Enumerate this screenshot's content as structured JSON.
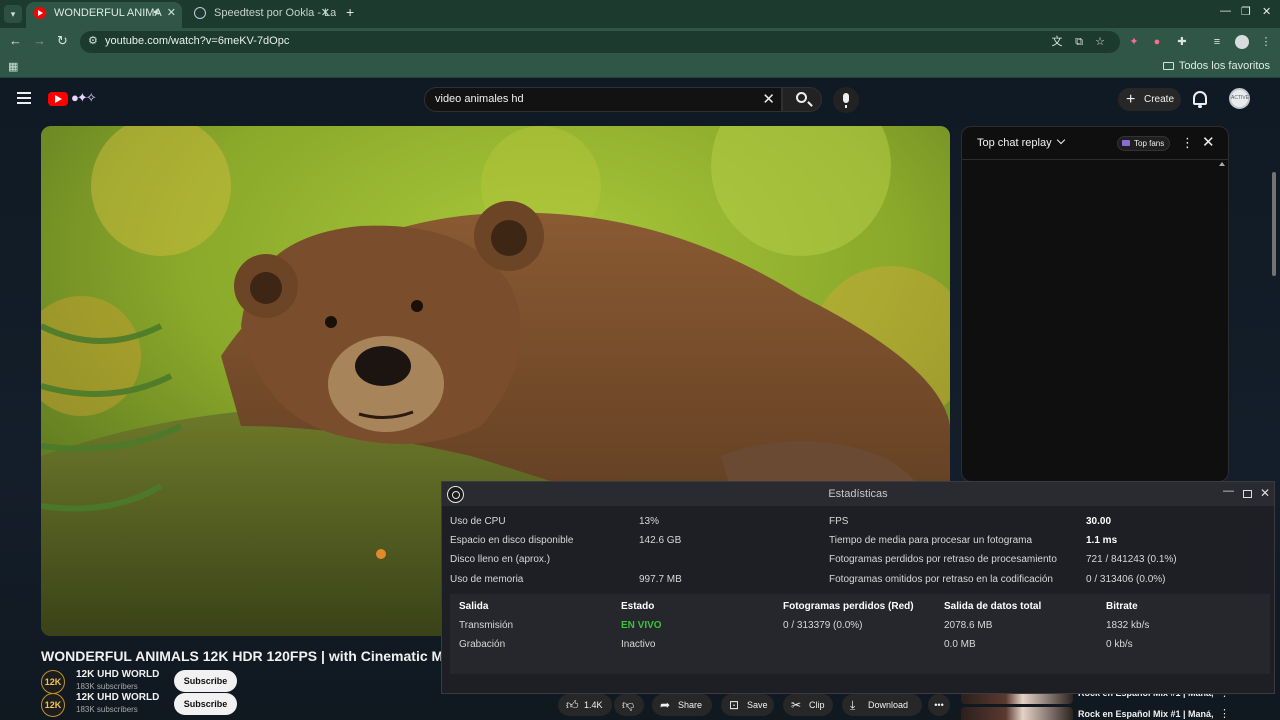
{
  "browser": {
    "tabs": [
      {
        "title": "WONDERFUL ANIMA",
        "active": true,
        "audio": true
      },
      {
        "title": "Speedtest por Ookla - La",
        "active": false
      }
    ],
    "url": "youtube.com/watch?v=6meKV-7dOpc",
    "bookmarks_folder": "Todos los favoritos"
  },
  "youtube": {
    "search_query": "video animales hd",
    "create_label": "Create",
    "avatar_text": "ACTIVE",
    "video": {
      "title": "WONDERFUL ANIMALS 12K HDR 120FPS | with Cinematic Music (C",
      "channel_avatar": "12K",
      "channel_name": "12K UHD WORLD",
      "subscribers": "183K subscribers",
      "subscribe_label": "Subscribe"
    },
    "actions": {
      "likes": "1.4K",
      "share": "Share",
      "save": "Save",
      "clip": "Clip",
      "download": "Download"
    },
    "chat": {
      "title": "Top chat replay",
      "badge": "Top fans"
    },
    "recommendations": [
      {
        "title": "Rock en Español Mix #1 | Maná,"
      },
      {
        "title": "Rock en Español Mix #1 | Maná,"
      }
    ]
  },
  "obs_stats": {
    "window_title": "Estadísticas",
    "left": [
      {
        "label": "Uso de CPU",
        "value": "13%"
      },
      {
        "label": "Espacio en disco disponible",
        "value": "142.6 GB"
      },
      {
        "label": "Disco lleno en (aprox.)",
        "value": ""
      },
      {
        "label": "Uso de memoria",
        "value": "997.7 MB"
      }
    ],
    "right": [
      {
        "label": "FPS",
        "value": "30.00"
      },
      {
        "label": "Tiempo de media para procesar un fotograma",
        "value": "1.1 ms"
      },
      {
        "label": "Fotogramas perdidos por retraso de procesamiento",
        "value": "721 / 841243 (0.1%)"
      },
      {
        "label": "Fotogramas omitidos por retraso en la codificación",
        "value": "0 / 313406 (0.0%)"
      }
    ],
    "table": {
      "headers": [
        "Salida",
        "Estado",
        "Fotogramas perdidos (Red)",
        "Salida de datos total",
        "Bitrate"
      ],
      "rows": [
        [
          "Transmisión",
          "EN VIVO",
          "0 / 313379 (0.0%)",
          "2078.6 MB",
          "1832 kb/s"
        ],
        [
          "Grabación",
          "Inactivo",
          "",
          "0.0 MB",
          "0 kb/s"
        ]
      ]
    },
    "colors": {
      "live": "#39c439",
      "panel": "#1e1f24"
    }
  }
}
